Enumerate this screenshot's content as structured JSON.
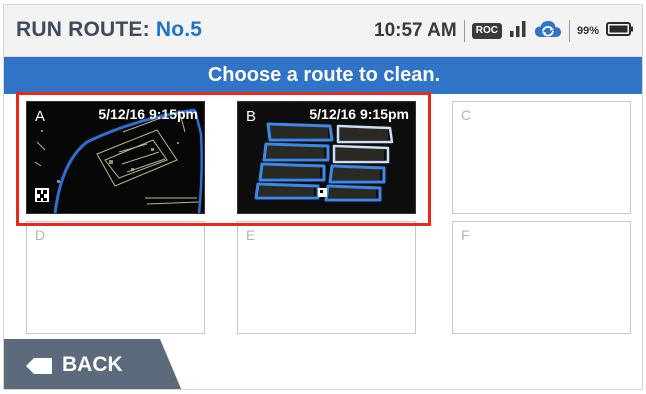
{
  "header": {
    "title_prefix": "RUN ROUTE:",
    "route_number": "No.5",
    "time": "10:57 AM",
    "badge": "ROC",
    "battery": "99%",
    "icons": [
      "signal-bars-icon",
      "cloud-sync-icon",
      "battery-icon"
    ]
  },
  "banner": {
    "text": "Choose a route to clean."
  },
  "routes": [
    {
      "letter": "A",
      "timestamp": "5/12/16 9:15pm",
      "has_map": true
    },
    {
      "letter": "B",
      "timestamp": "5/12/16 9:15pm",
      "has_map": true
    },
    {
      "letter": "C",
      "timestamp": "",
      "has_map": false
    },
    {
      "letter": "D",
      "timestamp": "",
      "has_map": false
    },
    {
      "letter": "E",
      "timestamp": "",
      "has_map": false
    },
    {
      "letter": "F",
      "timestamp": "",
      "has_map": false
    }
  ],
  "footer": {
    "back_label": "BACK"
  },
  "colors": {
    "accent": "#2f74c7",
    "title": "#3d4b5c",
    "highlight": "#e8291c",
    "back_button": "#5b6b7c"
  }
}
